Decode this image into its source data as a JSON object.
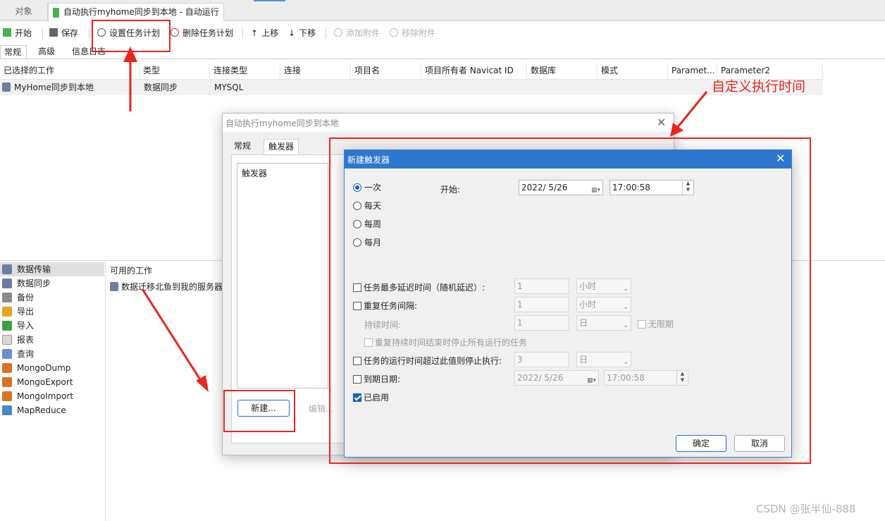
{
  "tabs": {
    "objects": "对象",
    "job": "自动执行myhome同步到本地 - 自动运行"
  },
  "toolbar": {
    "start": "开始",
    "save": "保存",
    "set_schedule": "设置任务计划",
    "delete_schedule": "删除任务计划",
    "move_up": "上移",
    "move_down": "下移",
    "add_attachment": "添加附件",
    "remove_attachment": "移除附件"
  },
  "subtabs": {
    "general": "常规",
    "advanced": "高级",
    "log": "信息日志"
  },
  "table": {
    "headers": [
      "已选择的工作",
      "类型",
      "连接类型",
      "连接",
      "项目名",
      "项目所有者 Navicat ID",
      "数据库",
      "模式",
      "Paramet...",
      "Parameter2"
    ],
    "row": {
      "job": "MyHome同步到本地",
      "type": "数据同步",
      "conn_type": "MYSQL"
    }
  },
  "left_list": [
    "数据传输",
    "数据同步",
    "备份",
    "导出",
    "导入",
    "报表",
    "查询",
    "MongoDump",
    "MongoExport",
    "MongoImport",
    "MapReduce"
  ],
  "available": {
    "title": "可用的工作",
    "item": "数据迁移北鱼到我的服务器"
  },
  "dialog1": {
    "title": "自动执行myhome同步到本地",
    "tab_general": "常规",
    "tab_trigger": "触发器",
    "list_title": "触发器",
    "new_button": "新建...",
    "edit_button": "编辑..."
  },
  "dialog2": {
    "title": "新建触发器",
    "radios": [
      "一次",
      "每天",
      "每周",
      "每月"
    ],
    "start_label": "开始:",
    "start_date": "2022/  5/26",
    "start_time": "17:00:58",
    "max_delay_label": "任务最多延迟时间（随机延迟）:",
    "max_delay_value": "1",
    "max_delay_unit": "小时",
    "repeat_label": "重复任务间隔:",
    "repeat_value": "1",
    "repeat_unit": "小时",
    "duration_label": "持续时间:",
    "duration_value": "1",
    "duration_unit": "日",
    "unlimited": "无限期",
    "stop_on_end": "重复持续时间结束时停止所有运行的任务",
    "stop_if_over_label": "任务的运行时间超过此值则停止执行:",
    "stop_if_over_value": "3",
    "stop_if_over_unit": "日",
    "expire_label": "到期日期:",
    "expire_date": "2022/  5/26",
    "expire_time": "17:00:58",
    "enabled_label": "已启用",
    "ok": "确定",
    "cancel": "取消"
  },
  "annotation": {
    "custom_time": "自定义执行时间",
    "color": "#e8261b"
  },
  "watermark": "CSDN @张半仙-888"
}
